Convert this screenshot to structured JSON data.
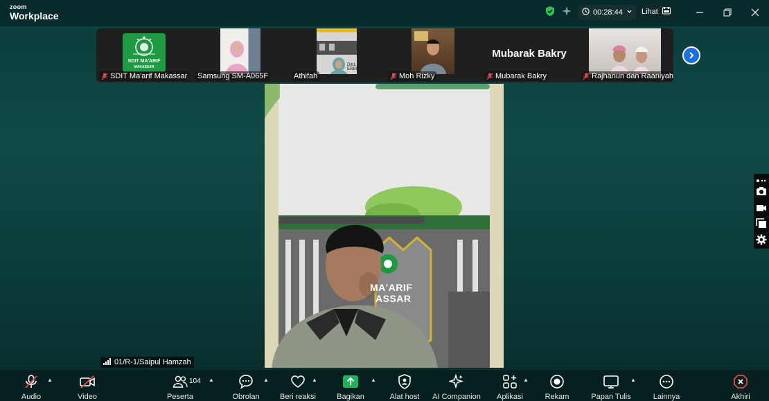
{
  "app": {
    "brand_top": "zoom",
    "brand_bottom": "Workplace"
  },
  "titlebar": {
    "timer": "00:28:44",
    "view_label": "Lihat"
  },
  "participants": [
    {
      "name": "SDIT Ma'arif Makassar",
      "muted": true,
      "logo_line1": "SDIT MA'ARIF",
      "logo_line2": "MAKASSAR"
    },
    {
      "name": "Samsung SM-A065F",
      "muted": false
    },
    {
      "name": "Athifah",
      "muted": false,
      "sign_text": "DIKL\nERBI"
    },
    {
      "name": "Moh Rizky",
      "muted": true
    },
    {
      "name": "Mubarak Bakry",
      "muted": true,
      "big_name": "Mubarak Bakry"
    },
    {
      "name": "Rajhanun dan Raaniyah",
      "muted": true
    }
  ],
  "main_video": {
    "speaker_label": "01/R-1/Saipul Hamzah",
    "background_text_1": "MA'ARIF",
    "background_text_2": "ASSAR"
  },
  "toolbar": {
    "audio": "Audio",
    "video": "Video",
    "participants": "Peserta",
    "participants_count": "104",
    "chat": "Obrolan",
    "react": "Beri reaksi",
    "share": "Bagikan",
    "host_tools": "Alat host",
    "ai_companion": "AI Companion",
    "apps": "Aplikasi",
    "record": "Rekam",
    "whiteboard": "Papan Tulis",
    "more": "Lainnya",
    "end": "Akhiri"
  },
  "colors": {
    "share_green": "#1db35a",
    "end_red": "#e5464e",
    "accent_blue": "#1a6ee6",
    "shield_green": "#31c452"
  }
}
